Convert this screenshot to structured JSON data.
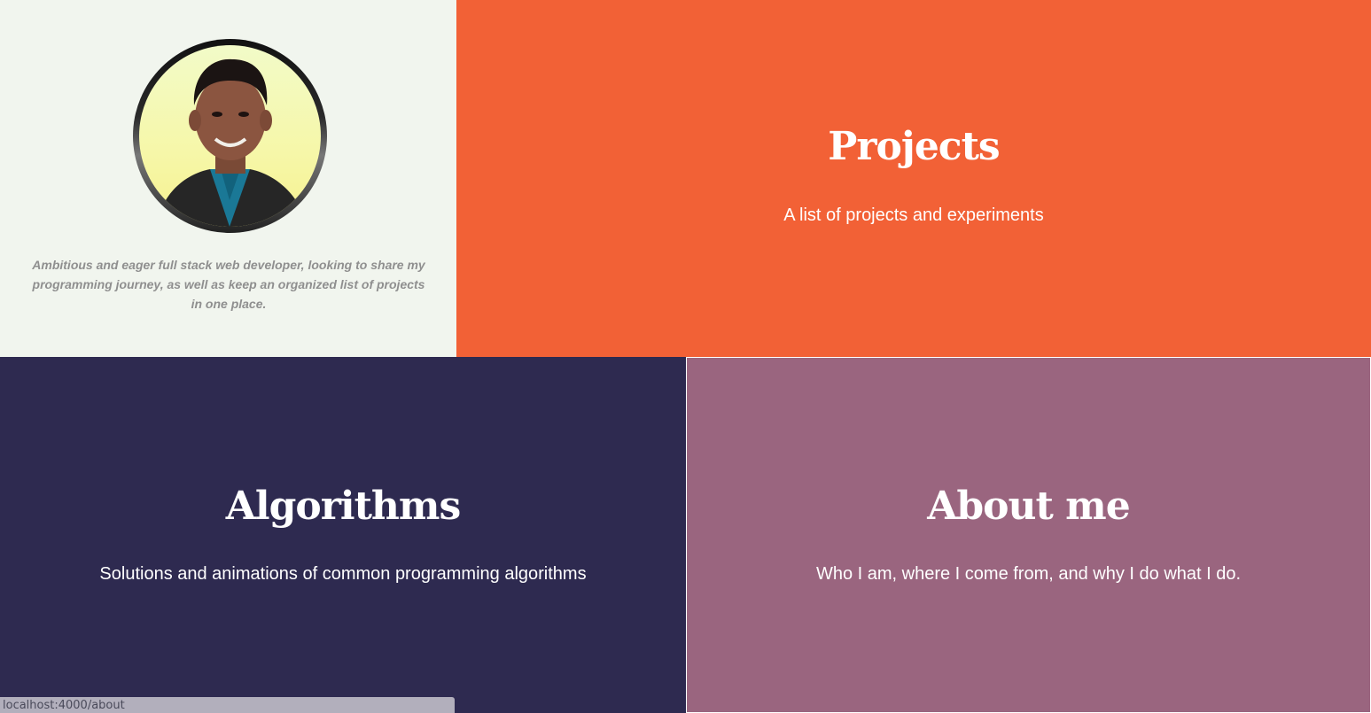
{
  "profile": {
    "bio": "Ambitious and eager full stack web developer, looking to share my programming journey, as well as keep an organized list of projects in one place."
  },
  "tiles": {
    "projects": {
      "title": "Projects",
      "subtitle": "A list of projects and experiments"
    },
    "algorithms": {
      "title": "Algorithms",
      "subtitle": "Solutions and animations of common programming algorithms"
    },
    "about": {
      "title": "About me",
      "subtitle": "Who I am, where I come from, and why I do what I do."
    }
  },
  "status_bar": {
    "url": "localhost:4000/about"
  },
  "colors": {
    "profile_bg": "#f1f5ee",
    "projects_bg": "#f26136",
    "algorithms_bg": "#2e2a50",
    "about_bg": "#9a657f"
  }
}
